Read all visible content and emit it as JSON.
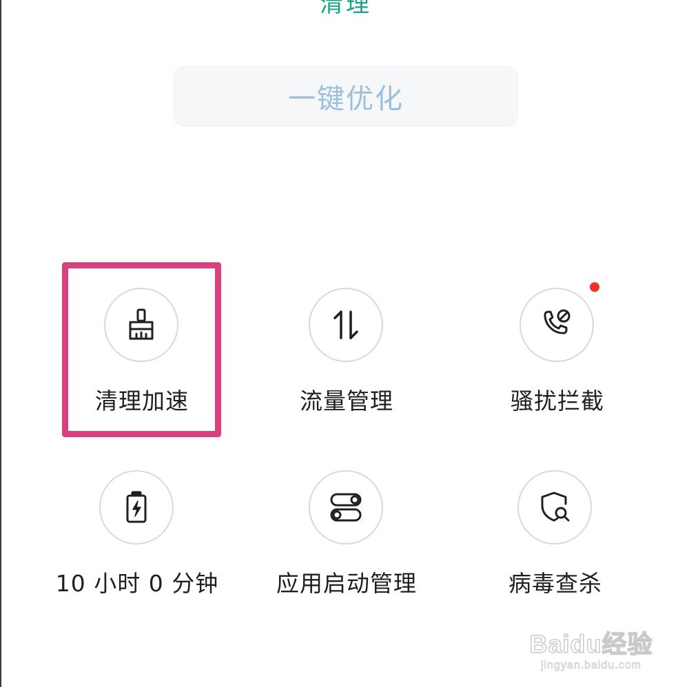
{
  "header": {
    "partial_title": "清理"
  },
  "optimize": {
    "label": "一键优化"
  },
  "tiles": [
    {
      "label": "清理加速",
      "icon": "broom-icon"
    },
    {
      "label": "流量管理",
      "icon": "data-transfer-icon"
    },
    {
      "label": "骚扰拦截",
      "icon": "call-block-icon",
      "badge": true
    },
    {
      "label": "10 小时 0 分钟",
      "icon": "battery-icon"
    },
    {
      "label": "应用启动管理",
      "icon": "toggle-switches-icon"
    },
    {
      "label": "病毒查杀",
      "icon": "shield-search-icon"
    }
  ],
  "highlight": {
    "target": "清理加速",
    "color": "#d9407e"
  },
  "watermark": {
    "logo": "Baidu经验",
    "sub": "jingyan.baidu.com"
  },
  "colors": {
    "accent_green": "#1aa38a",
    "optimize_text": "#9cc0dc",
    "badge_red": "#f0331f",
    "highlight_pink": "#d9407e"
  }
}
